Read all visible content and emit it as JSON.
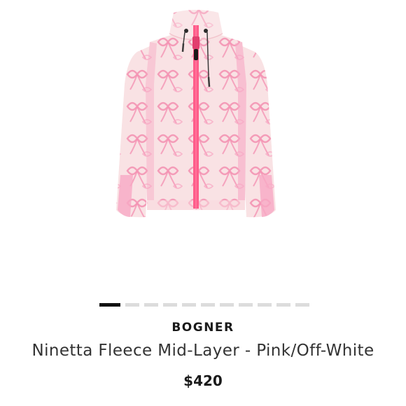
{
  "product": {
    "brand": "BOGNER",
    "name": "Ninetta Fleece Mid-Layer - Pink/Off-White",
    "price": "$420",
    "image": {
      "icon": "pink-fleece-jacket-image",
      "colors": {
        "body": "#f9e2e4",
        "pattern": "#f48fb1",
        "zipper": "#ff5c8a",
        "side_panel": "#f7a9c4"
      }
    }
  },
  "carousel": {
    "total_slides": 11,
    "active_index": 0
  }
}
